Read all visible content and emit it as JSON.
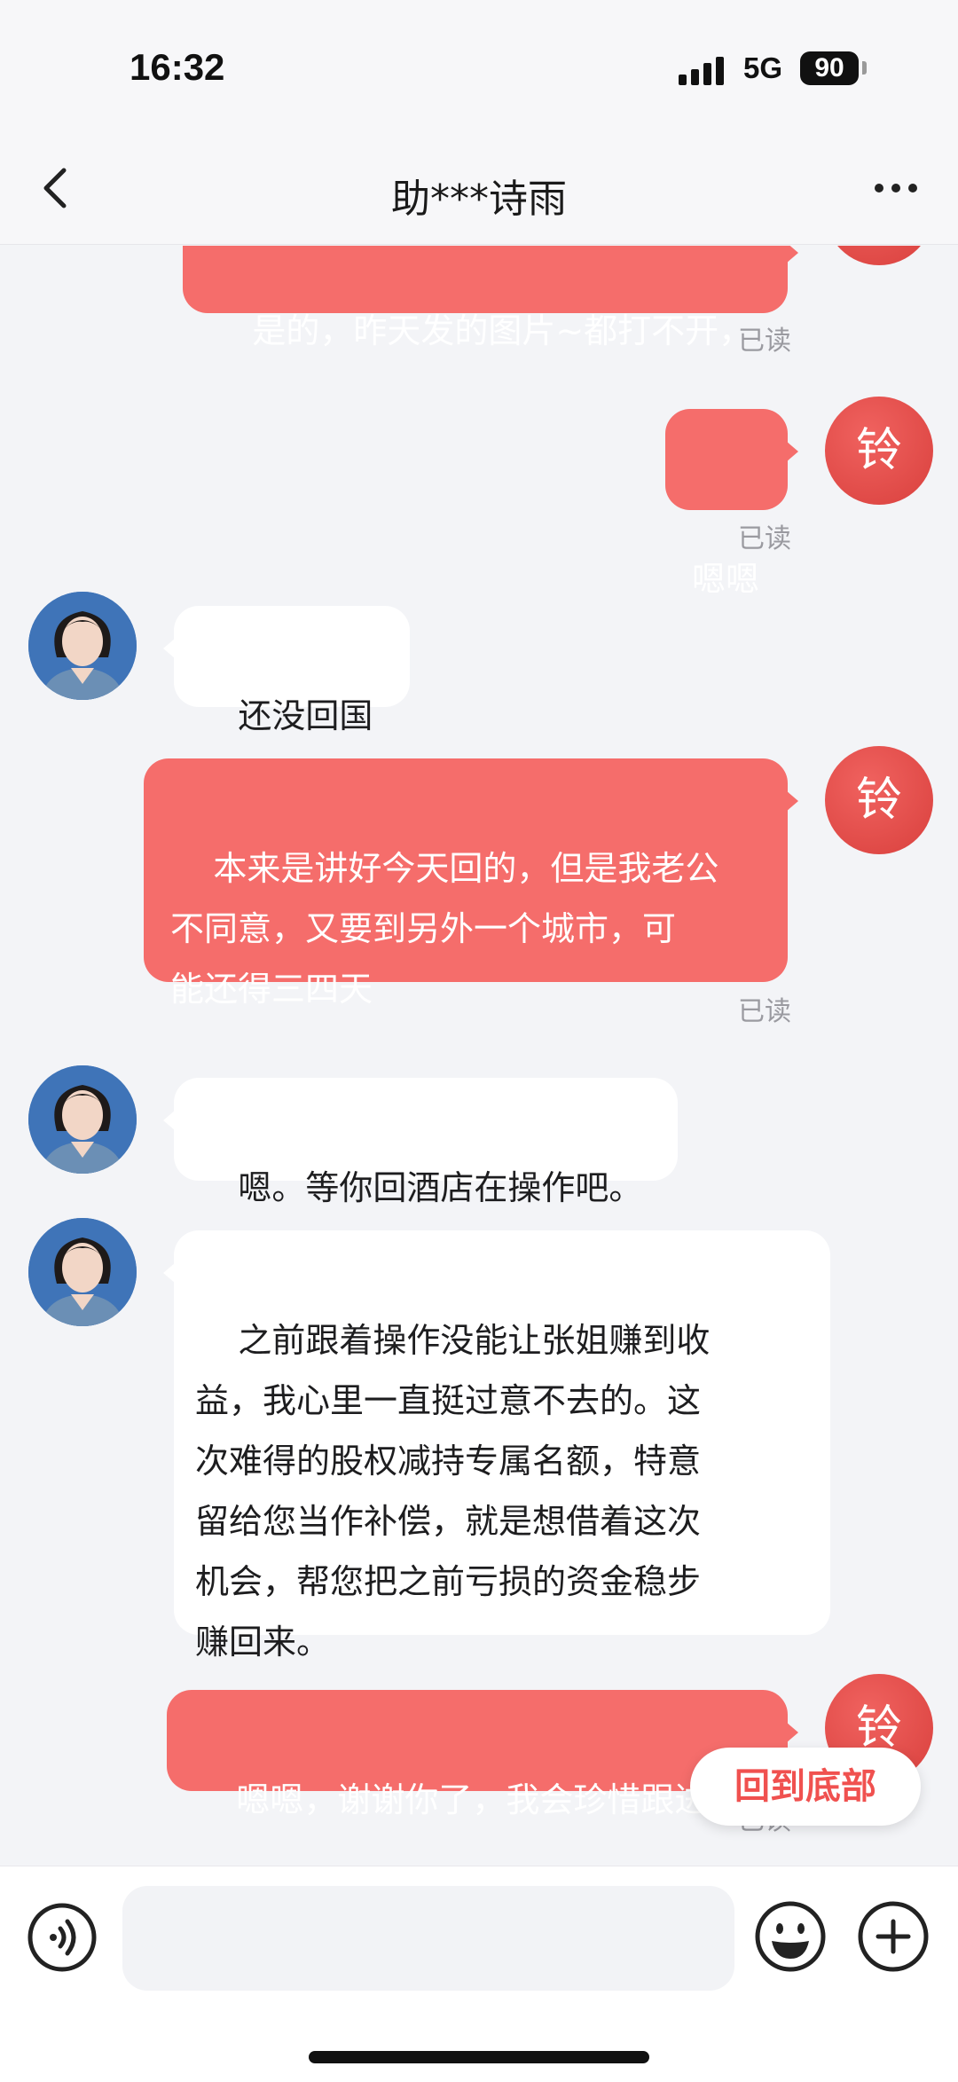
{
  "status_bar": {
    "time": "16:32",
    "network": "5G",
    "battery": "90"
  },
  "nav": {
    "title": "助***诗雨"
  },
  "me_avatar_char": "铃",
  "messages": [
    {
      "from": "me",
      "text": "是的，昨天发的图片~都打不开，",
      "read": "已读"
    },
    {
      "from": "me",
      "text": "嗯嗯",
      "read": "已读"
    },
    {
      "from": "her",
      "text": "还没回国啊"
    },
    {
      "from": "me",
      "text": "本来是讲好今天回的，但是我老公\n不同意，又要到另外一个城市，可\n能还得三四天",
      "read": "已读"
    },
    {
      "from": "her",
      "text": "嗯。等你回酒店在操作吧。"
    },
    {
      "from": "her",
      "text": "之前跟着操作没能让张姐赚到收\n益，我心里一直挺过意不去的。这\n次难得的股权减持专属名额，特意\n留给您当作补偿，就是想借着这次\n机会，帮您把之前亏损的资金稳步\n赚回来。"
    },
    {
      "from": "me",
      "text": "嗯嗯，谢谢你了，我会珍惜跟进的",
      "read": "已读"
    }
  ],
  "back_to_bottom_label": "回到底部",
  "colors": {
    "bubble_out": "#f56d6b",
    "accent": "#f0514f",
    "background": "#f3f4f7"
  },
  "icons": [
    "back-chevron-icon",
    "more-dots-icon",
    "voice-icon",
    "emoji-icon",
    "plus-icon"
  ]
}
